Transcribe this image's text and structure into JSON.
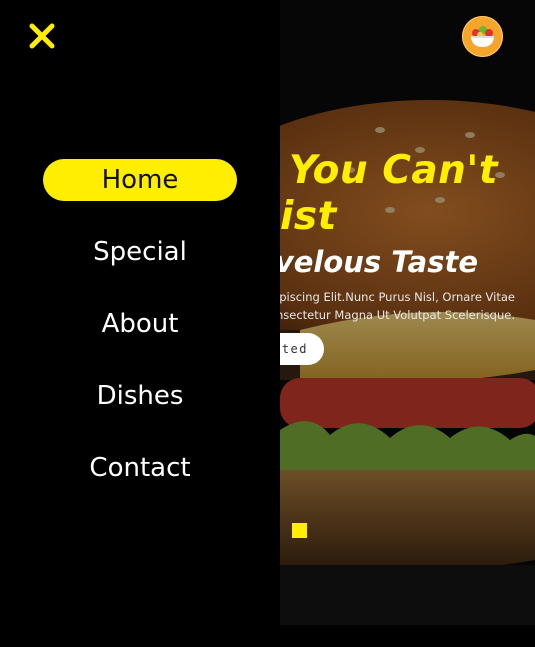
{
  "menu": {
    "close_icon": "close-icon",
    "items": [
      {
        "label": "Home",
        "active": true
      },
      {
        "label": "Special",
        "active": false
      },
      {
        "label": "About",
        "active": false
      },
      {
        "label": "Dishes",
        "active": false
      },
      {
        "label": "Contact",
        "active": false
      }
    ]
  },
  "logo": {
    "icon": "salad-bowl-icon"
  },
  "hero": {
    "headline_line1": "You Can't",
    "headline_line2": "ist",
    "subheadline": "rvelous Taste",
    "description_line1": "ipiscing Elit.Nunc Purus Nisl, Ornare Vitae",
    "description_line2": "nsectetur Magna Ut Volutpat Scelerisque.",
    "cta_label": "rted"
  },
  "colors": {
    "accent": "#ffee00",
    "background": "#000000",
    "text": "#ffffff"
  }
}
